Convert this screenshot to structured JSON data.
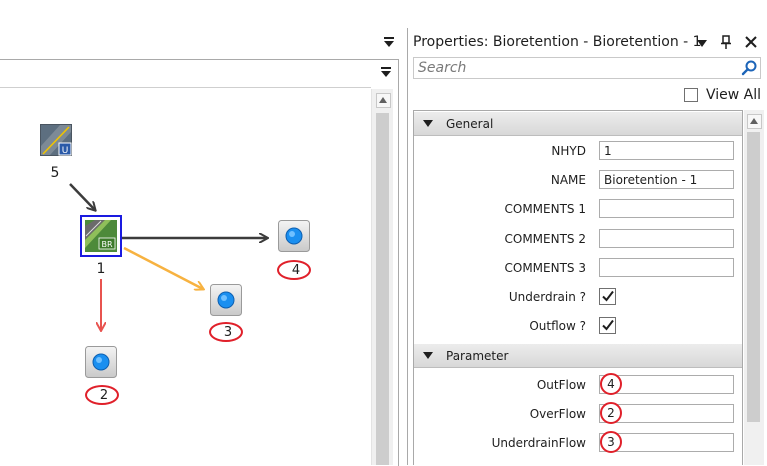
{
  "canvas": {
    "nodes": [
      {
        "name": "urban-node",
        "label": "5"
      },
      {
        "name": "bioretention-node",
        "label": "1"
      },
      {
        "name": "outlet-node-4",
        "label": "4"
      },
      {
        "name": "outlet-node-3",
        "label": "3"
      },
      {
        "name": "outlet-node-2",
        "label": "2"
      }
    ],
    "icon_badges": {
      "urban": "U",
      "bioretention": "BR"
    },
    "colors": {
      "flow_arrow": "#3c3c3c",
      "overflow_arrow": "#f7b240",
      "underdrain_arrow": "#e8534f",
      "selection": "#1a1ae0",
      "annotation": "#e0202a"
    }
  },
  "properties": {
    "title": "Properties: Bioretention - Bioretention - 1",
    "search_placeholder": "Search",
    "view_all_label": "View All",
    "sections": {
      "general": {
        "label": "General",
        "rows": [
          {
            "label": "NHYD",
            "value": "1"
          },
          {
            "label": "NAME",
            "value": "Bioretention - 1"
          },
          {
            "label": "COMMENTS 1",
            "value": ""
          },
          {
            "label": "COMMENTS 2",
            "value": ""
          },
          {
            "label": "COMMENTS 3",
            "value": ""
          }
        ],
        "checks": [
          {
            "label": "Underdrain ?",
            "checked": true
          },
          {
            "label": "Outflow ?",
            "checked": true
          }
        ]
      },
      "parameter": {
        "label": "Parameter",
        "rows": [
          {
            "label": "OutFlow",
            "value": "4"
          },
          {
            "label": "OverFlow",
            "value": "2"
          },
          {
            "label": "UnderdrainFlow",
            "value": "3"
          }
        ]
      }
    }
  }
}
